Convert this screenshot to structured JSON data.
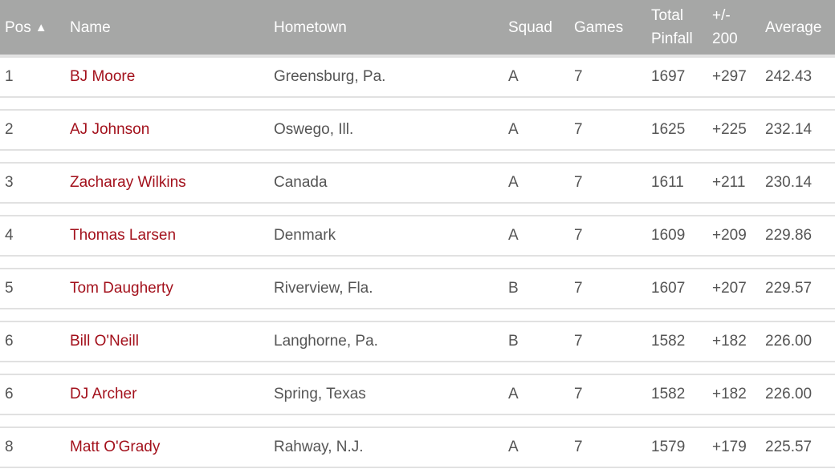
{
  "colors": {
    "header_bg": "#a6a7a6",
    "header_text": "#ffffff",
    "name_link": "#a3111c",
    "body_text": "#555555",
    "row_border": "#e1e1e1"
  },
  "header": {
    "pos": "Pos",
    "sort_icon": "▲",
    "name": "Name",
    "hometown": "Hometown",
    "squad": "Squad",
    "games": "Games",
    "total_line1": "Total",
    "total_line2": "Pinfall",
    "pm_line1": "+/-",
    "pm_line2": "200",
    "average": "Average"
  },
  "rows": [
    {
      "pos": "1",
      "name": "BJ Moore",
      "hometown": "Greensburg, Pa.",
      "squad": "A",
      "games": "7",
      "total": "1697",
      "pm": "+297",
      "average": "242.43"
    },
    {
      "pos": "2",
      "name": "AJ Johnson",
      "hometown": "Oswego, Ill.",
      "squad": "A",
      "games": "7",
      "total": "1625",
      "pm": "+225",
      "average": "232.14"
    },
    {
      "pos": "3",
      "name": "Zacharay Wilkins",
      "hometown": "Canada",
      "squad": "A",
      "games": "7",
      "total": "1611",
      "pm": "+211",
      "average": "230.14"
    },
    {
      "pos": "4",
      "name": "Thomas Larsen",
      "hometown": "Denmark",
      "squad": "A",
      "games": "7",
      "total": "1609",
      "pm": "+209",
      "average": "229.86"
    },
    {
      "pos": "5",
      "name": "Tom Daugherty",
      "hometown": "Riverview, Fla.",
      "squad": "B",
      "games": "7",
      "total": "1607",
      "pm": "+207",
      "average": "229.57"
    },
    {
      "pos": "6",
      "name": "Bill O'Neill",
      "hometown": "Langhorne, Pa.",
      "squad": "B",
      "games": "7",
      "total": "1582",
      "pm": "+182",
      "average": "226.00"
    },
    {
      "pos": "6",
      "name": "DJ Archer",
      "hometown": "Spring, Texas",
      "squad": "A",
      "games": "7",
      "total": "1582",
      "pm": "+182",
      "average": "226.00"
    },
    {
      "pos": "8",
      "name": "Matt O'Grady",
      "hometown": "Rahway, N.J.",
      "squad": "A",
      "games": "7",
      "total": "1579",
      "pm": "+179",
      "average": "225.57"
    }
  ]
}
